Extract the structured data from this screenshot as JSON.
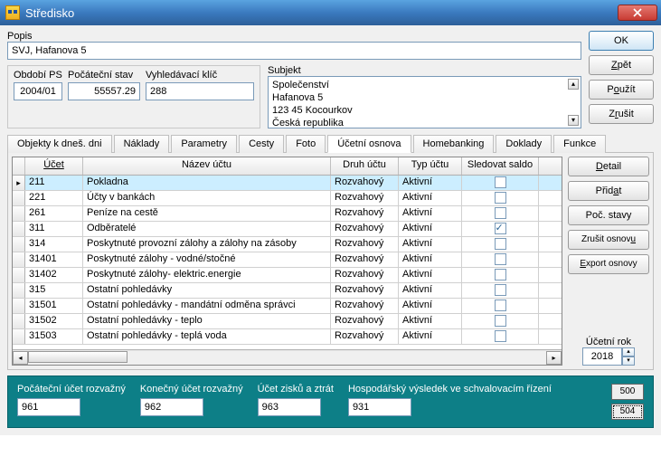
{
  "window": {
    "title": "Středisko"
  },
  "popis": {
    "label": "Popis",
    "value": "SVJ, Hafanova 5"
  },
  "obdobi": {
    "label": "Období PS",
    "value": "2004/01"
  },
  "pocatecni": {
    "label": "Počáteční stav",
    "value": "55557.29"
  },
  "vyhledavaci": {
    "label": "Vyhledávací klíč",
    "value": "288"
  },
  "subjekt": {
    "label": "Subjekt",
    "lines": [
      "Společenství",
      "Hafanova 5",
      "123 45 Kocourkov",
      "Česká republika"
    ]
  },
  "right_buttons": {
    "ok": "OK",
    "zpet": "Zpět",
    "pouzit": "Použít",
    "zrusit": "Zrušit"
  },
  "tabs": {
    "objekty": "Objekty k dneš. dni",
    "naklady": "Náklady",
    "parametry": "Parametry",
    "cesty": "Cesty",
    "foto": "Foto",
    "ucetni": "Účetní osnova",
    "homebanking": "Homebanking",
    "doklady": "Doklady",
    "funkce": "Funkce"
  },
  "grid": {
    "headers": {
      "ucet": "Účet",
      "nazev": "Název účtu",
      "druh": "Druh účtu",
      "typ": "Typ účtu",
      "saldo": "Sledovat saldo"
    },
    "rows": [
      {
        "ucet": "211",
        "nazev": "Pokladna",
        "druh": "Rozvahový",
        "typ": "Aktivní",
        "saldo": false,
        "selected": true
      },
      {
        "ucet": "221",
        "nazev": "Účty v bankách",
        "druh": "Rozvahový",
        "typ": "Aktivní",
        "saldo": false
      },
      {
        "ucet": "261",
        "nazev": "Peníze na cestě",
        "druh": "Rozvahový",
        "typ": "Aktivní",
        "saldo": false
      },
      {
        "ucet": "311",
        "nazev": "Odběratelé",
        "druh": "Rozvahový",
        "typ": "Aktivní",
        "saldo": true
      },
      {
        "ucet": "314",
        "nazev": "Poskytnuté provozní zálohy a zálohy na zásoby",
        "druh": "Rozvahový",
        "typ": "Aktivní",
        "saldo": false
      },
      {
        "ucet": "31401",
        "nazev": "Poskytnuté zálohy - vodné/stočné",
        "druh": "Rozvahový",
        "typ": "Aktivní",
        "saldo": false
      },
      {
        "ucet": "31402",
        "nazev": "Poskytnuté zálohy- elektric.energie",
        "druh": "Rozvahový",
        "typ": "Aktivní",
        "saldo": false
      },
      {
        "ucet": "315",
        "nazev": "Ostatní pohledávky",
        "druh": "Rozvahový",
        "typ": "Aktivní",
        "saldo": false
      },
      {
        "ucet": "31501",
        "nazev": "Ostatní pohledávky - mandátní odměna správci",
        "druh": "Rozvahový",
        "typ": "Aktivní",
        "saldo": false
      },
      {
        "ucet": "31502",
        "nazev": "Ostatní pohledávky - teplo",
        "druh": "Rozvahový",
        "typ": "Aktivní",
        "saldo": false
      },
      {
        "ucet": "31503",
        "nazev": "Ostatní pohledávky - teplá voda",
        "druh": "Rozvahový",
        "typ": "Aktivní",
        "saldo": false
      }
    ]
  },
  "side_buttons": {
    "detail": "Detail",
    "pridat": "Přidat",
    "poc_stavy": "Poč. stavy",
    "zrusit_osnovu": "Zrušit osnovu",
    "export_osnovy": "Export osnovy"
  },
  "year": {
    "label": "Účetní rok",
    "value": "2018"
  },
  "teal": {
    "poc_rozvaz": {
      "label": "Počáteční účet rozvažný",
      "value": "961"
    },
    "kon_rozvaz": {
      "label": "Konečný účet rozvažný",
      "value": "962"
    },
    "zisk_ztrat": {
      "label": "Účet zisků a ztrát",
      "value": "963"
    },
    "hosp_vys": {
      "label": "Hospodářský výsledek ve schvalovacím řízení",
      "value": "931"
    },
    "btn500": "500",
    "btn504": "504"
  }
}
